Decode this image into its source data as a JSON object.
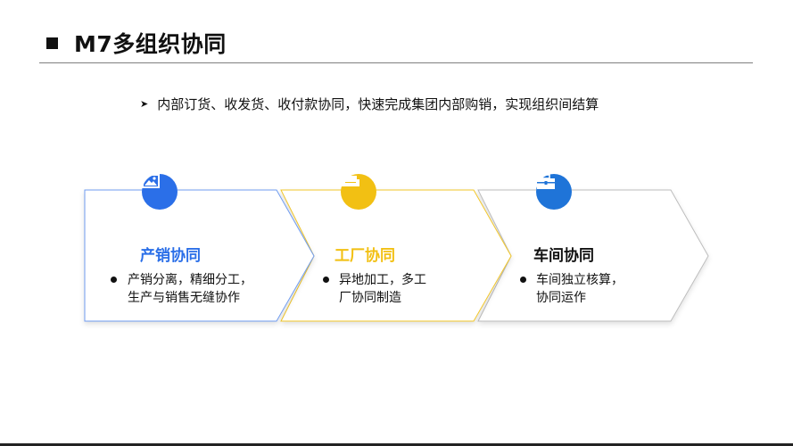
{
  "title": "M7多组织协同",
  "summary": "内部订货、收发货、收付款协同，快速完成集团内部购销，实现组织间结算",
  "steps": [
    {
      "title": "产销协同",
      "desc_line1": "产销分离，精细分工，",
      "desc_line2": "生产与销售无缝协作",
      "color": "#2b6fe8",
      "icon": "image-icon"
    },
    {
      "title": "工厂协同",
      "desc_line1": "异地加工，多工",
      "desc_line2": "厂协同制造",
      "color": "#f2c013",
      "icon": "sofa-icon"
    },
    {
      "title": "车间协同",
      "desc_line1": "车间独立核算，",
      "desc_line2": "协同运作",
      "color": "#1f74d8",
      "icon": "toolbox-icon"
    }
  ],
  "colors": {
    "step1_border": "#6f9cf0",
    "step2_border": "#f2c72b",
    "step3_border": "#bdbdbd"
  }
}
